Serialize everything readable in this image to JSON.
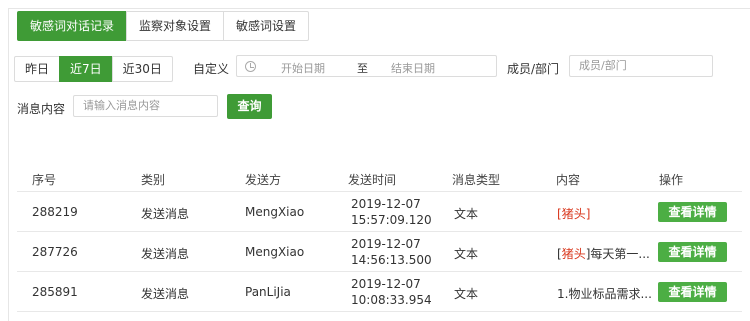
{
  "tabs": [
    {
      "label": "敏感词对话记录",
      "active": true
    },
    {
      "label": "监察对象设置",
      "active": false
    },
    {
      "label": "敏感词设置",
      "active": false
    }
  ],
  "period": [
    {
      "label": "昨日",
      "active": false
    },
    {
      "label": "近7日",
      "active": true
    },
    {
      "label": "近30日",
      "active": false
    }
  ],
  "filters": {
    "custom_label": "自定义",
    "start_placeholder": "开始日期",
    "range_separator": "至",
    "end_placeholder": "结束日期",
    "member_label": "成员/部门",
    "member_placeholder": "成员/部门",
    "content_label": "消息内容",
    "content_placeholder": "请输入消息内容",
    "query_button": "查询"
  },
  "table": {
    "headers": [
      "序号",
      "类别",
      "发送方",
      "发送时间",
      "消息类型",
      "内容",
      "操作"
    ],
    "rows": [
      {
        "id": "288219",
        "category": "发送消息",
        "sender": "MengXiao",
        "time": "2019-12-07 15:57:09.120",
        "type": "文本",
        "content_prefix": "[",
        "content_kw": "猪头",
        "content_suffix": "]",
        "action": "查看详情"
      },
      {
        "id": "287726",
        "category": "发送消息",
        "sender": "MengXiao",
        "time": "2019-12-07 14:56:13.500",
        "type": "文本",
        "content_prefix": "[",
        "content_kw": "猪头",
        "content_suffix": "]每天第一...",
        "action": "查看详情"
      },
      {
        "id": "285891",
        "category": "发送消息",
        "sender": "PanLiJia",
        "time": "2019-12-07 10:08:33.954",
        "type": "文本",
        "content_prefix": "1.物业标品需求...",
        "content_kw": "",
        "content_suffix": "",
        "action": "查看详情"
      }
    ]
  },
  "colors": {
    "accent": "#3f9b36",
    "keyword": "#d9381e"
  }
}
